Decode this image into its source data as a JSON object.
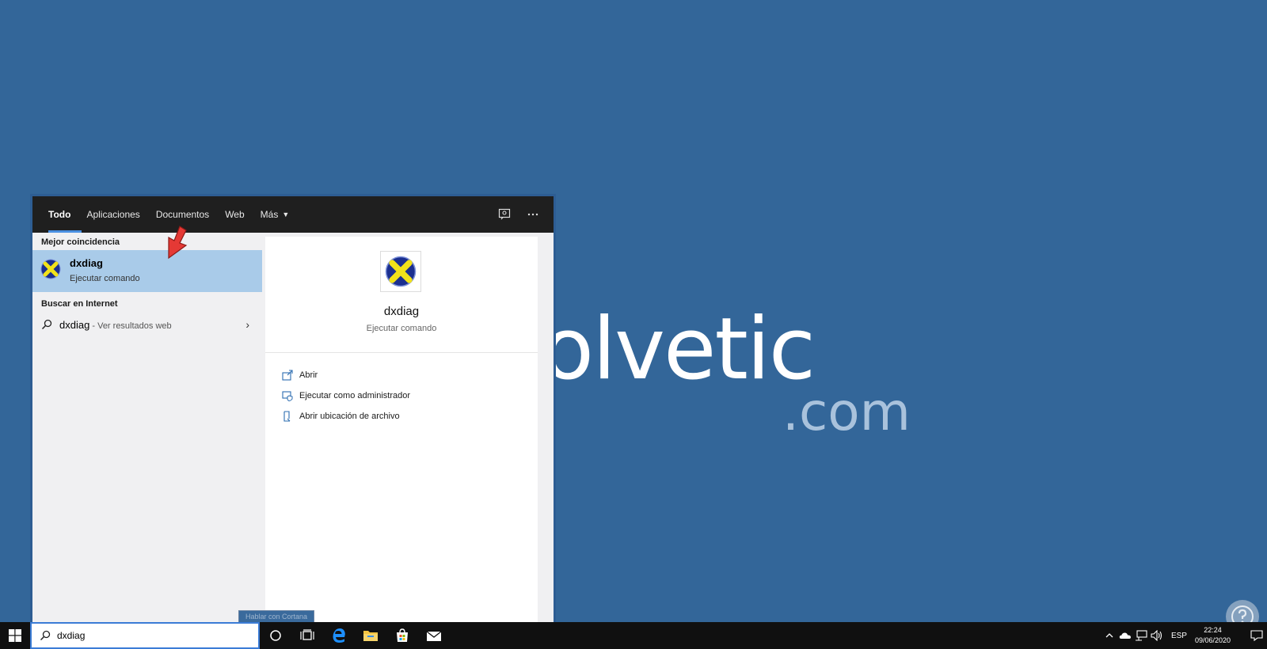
{
  "wallpaper": {
    "logo_text": "olvetic",
    "dotcom_text": ".com"
  },
  "search_panel": {
    "tabs": [
      {
        "label": "Todo",
        "active": true
      },
      {
        "label": "Aplicaciones",
        "active": false
      },
      {
        "label": "Documentos",
        "active": false
      },
      {
        "label": "Web",
        "active": false
      },
      {
        "label": "Más",
        "active": false
      }
    ],
    "header_icons": [
      "feedback-icon",
      "more-options-icon"
    ],
    "best_match_label": "Mejor coincidencia",
    "best_match": {
      "name": "dxdiag",
      "subtitle": "Ejecutar comando",
      "icon": "directx-icon"
    },
    "web_label": "Buscar en Internet",
    "web_result": {
      "query": "dxdiag",
      "suffix": " - Ver resultados web"
    },
    "detail": {
      "title": "dxdiag",
      "subtitle": "Ejecutar comando",
      "actions": [
        {
          "label": "Abrir",
          "icon": "open-icon"
        },
        {
          "label": "Ejecutar como administrador",
          "icon": "run-as-admin-icon"
        },
        {
          "label": "Abrir ubicación de archivo",
          "icon": "file-location-icon"
        }
      ]
    }
  },
  "cortana_tip": "Hablar con Cortana",
  "taskbar": {
    "search_value": "dxdiag",
    "pinned_icons": [
      "cortana-icon",
      "task-view-icon",
      "edge-icon",
      "file-explorer-icon",
      "store-icon",
      "mail-icon"
    ],
    "tray": {
      "language": "ESP",
      "time": "22:24",
      "date": "09/06/2020"
    }
  },
  "colors": {
    "desktop": "#336699",
    "selection": "#a9cbe9",
    "accent": "#4a90e2",
    "annotation_arrow": "#e53935"
  }
}
